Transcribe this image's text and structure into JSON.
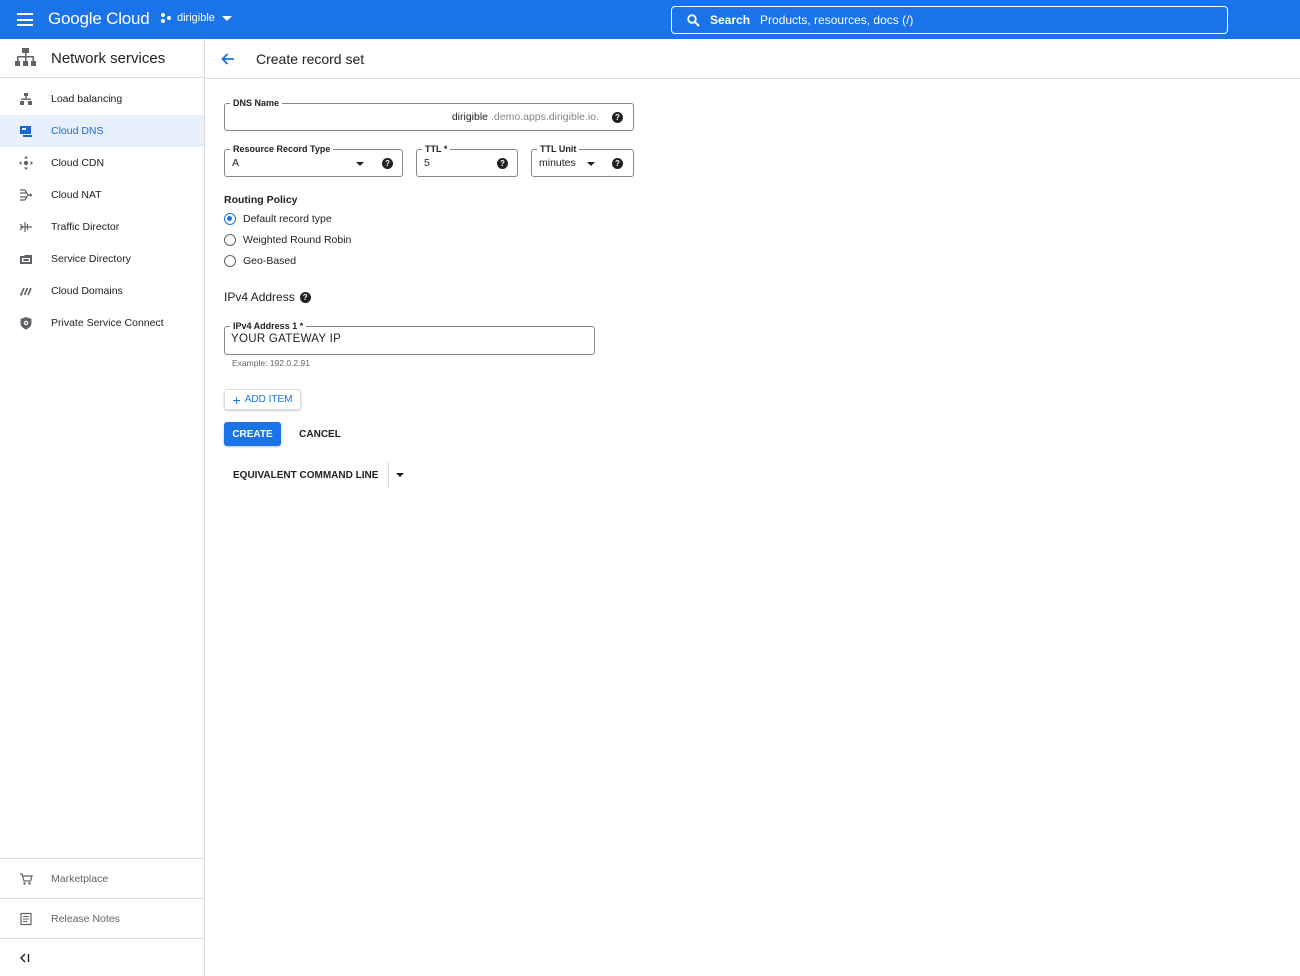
{
  "topbar": {
    "logo": "Google Cloud",
    "project": "dirigible",
    "search_label": "Search",
    "search_placeholder": "Products, resources, docs (/)"
  },
  "sidebar": {
    "title": "Network services",
    "items": [
      {
        "label": "Load balancing",
        "icon": "load-balancing-icon",
        "active": false
      },
      {
        "label": "Cloud DNS",
        "icon": "cloud-dns-icon",
        "active": true
      },
      {
        "label": "Cloud CDN",
        "icon": "cloud-cdn-icon",
        "active": false
      },
      {
        "label": "Cloud NAT",
        "icon": "cloud-nat-icon",
        "active": false
      },
      {
        "label": "Traffic Director",
        "icon": "traffic-director-icon",
        "active": false
      },
      {
        "label": "Service Directory",
        "icon": "service-directory-icon",
        "active": false
      },
      {
        "label": "Cloud Domains",
        "icon": "cloud-domains-icon",
        "active": false
      },
      {
        "label": "Private Service Connect",
        "icon": "private-service-connect-icon",
        "active": false
      }
    ],
    "bottom": {
      "marketplace": "Marketplace",
      "release_notes": "Release Notes"
    }
  },
  "page": {
    "title": "Create record set"
  },
  "form": {
    "dns_name": {
      "label": "DNS Name",
      "value": "dirigible",
      "suffix": ".demo.apps.dirigible.io."
    },
    "record_type": {
      "label": "Resource Record Type",
      "value": "A"
    },
    "ttl": {
      "label": "TTL *",
      "value": "5"
    },
    "ttl_unit": {
      "label": "TTL Unit",
      "value": "minutes"
    },
    "routing_policy": {
      "label": "Routing Policy",
      "options": [
        "Default record type",
        "Weighted Round Robin",
        "Geo-Based"
      ],
      "selected": "Default record type"
    },
    "ipv4": {
      "section_label": "IPv4 Address",
      "field_label": "IPv4 Address 1 *",
      "value": "YOUR GATEWAY IP",
      "hint": "Example: 192.0.2.91"
    },
    "add_item": "ADD ITEM",
    "create": "CREATE",
    "cancel": "CANCEL",
    "equivalent_command_line": "EQUIVALENT COMMAND LINE"
  },
  "colors": {
    "brand_blue": "#1a73e8",
    "active_bg": "#e8f0fe",
    "active_text": "#1967d2",
    "border": "#dadce0"
  }
}
